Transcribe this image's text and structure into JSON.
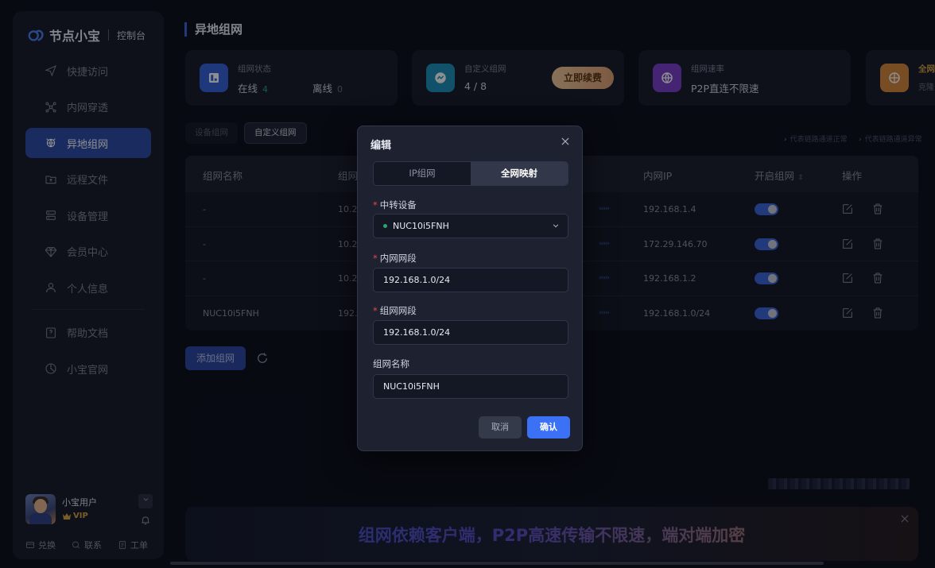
{
  "brand": {
    "name": "节点小宝",
    "sub": "控制台"
  },
  "sidebar": {
    "items": [
      {
        "label": "快捷访问",
        "icon": "send-icon"
      },
      {
        "label": "内网穿透",
        "icon": "network-icon"
      },
      {
        "label": "异地组网",
        "icon": "globe-bug-icon",
        "active": true
      },
      {
        "label": "远程文件",
        "icon": "folder-icon"
      },
      {
        "label": "设备管理",
        "icon": "server-icon"
      },
      {
        "label": "会员中心",
        "icon": "diamond-icon"
      },
      {
        "label": "个人信息",
        "icon": "user-icon"
      },
      {
        "label": "帮助文档",
        "icon": "help-icon"
      },
      {
        "label": "小宝官网",
        "icon": "compass-icon"
      }
    ],
    "user": {
      "name": "小宝用户",
      "badge": "VIP"
    },
    "footer": {
      "redeem": "兑换",
      "contact": "联系",
      "ticket": "工单"
    }
  },
  "page": {
    "title": "异地组网"
  },
  "cards": {
    "status": {
      "title": "组网状态",
      "online_label": "在线",
      "online": "4",
      "offline_label": "离线",
      "offline": "0"
    },
    "custom": {
      "title": "自定义组网",
      "value": "4 / 8",
      "renew": "立即续费"
    },
    "speed": {
      "title": "组网速率",
      "value": "P2P直连不限速"
    },
    "full": {
      "title": "全网",
      "value": "克隆"
    }
  },
  "tabs": {
    "device": "设备组网",
    "custom": "自定义组网"
  },
  "legend": {
    "normal": "代表链路通道正常",
    "error": "代表链路通道异常"
  },
  "table": {
    "headers": {
      "name": "组网名称",
      "segment": "组网",
      "lan_ip": "内网IP",
      "enable": "开启组网",
      "ops": "操作"
    },
    "rows": [
      {
        "name": "-",
        "segment": "10.20",
        "lan_ip": "192.168.1.4",
        "enabled": true
      },
      {
        "name": "-",
        "segment": "10.20",
        "lan_ip": "172.29.146.70",
        "enabled": true
      },
      {
        "name": "-",
        "segment": "10.20",
        "lan_ip": "192.168.1.2",
        "enabled": true
      },
      {
        "name": "NUC10i5FNH",
        "segment": "192.1",
        "lan_ip": "192.168.1.0/24",
        "enabled": true
      }
    ],
    "arrows": "›››››"
  },
  "actions": {
    "add": "添加组网"
  },
  "banner": {
    "text": "组网依赖客户端，P2P高速传输不限速，端对端加密"
  },
  "modal": {
    "title": "编辑",
    "seg": {
      "ip": "IP组网",
      "full": "全网映射"
    },
    "relay": {
      "label": "中转设备",
      "value": "NUC10i5FNH"
    },
    "lan": {
      "label": "内网网段",
      "value": "192.168.1.0/24"
    },
    "net": {
      "label": "组网网段",
      "value": "192.168.1.0/24"
    },
    "name": {
      "label": "组网名称",
      "value": "NUC10i5FNH"
    },
    "cancel": "取消",
    "confirm": "确认"
  },
  "colors": {
    "accent": "#3b63d8",
    "primary_button": "#3b72f5",
    "online": "#2ea46b",
    "required": "#e5484d"
  }
}
